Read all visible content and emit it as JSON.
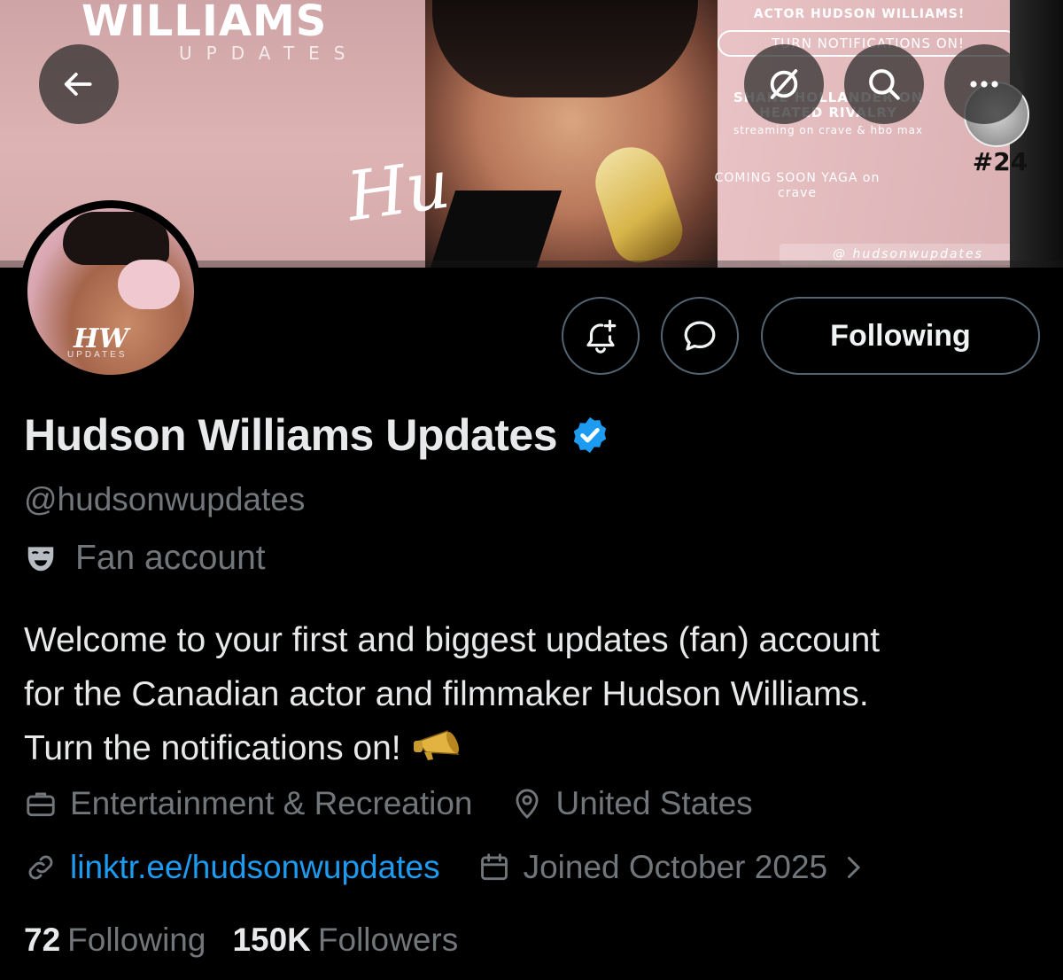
{
  "banner": {
    "wordmark_title": "WILLIAMS",
    "wordmark_subtitle": "UPDATES",
    "promo_line": "ACTOR HUDSON WILLIAMS!",
    "promo_notifications": "TURN NOTIFICATIONS ON!",
    "promo_show": "SHANE HOLLANDER ON HEATED RIVALRY",
    "promo_streaming": "streaming on crave & hbo max",
    "promo_coming_soon": "COMING SOON YAGA on crave",
    "promo_handle": "@ hudsonwupdates",
    "promo_number": "#24"
  },
  "nav": {
    "back_icon": "arrow-left-icon",
    "grok_icon": "grok-icon",
    "search_icon": "search-icon",
    "more_icon": "more-icon"
  },
  "actions": {
    "notify_icon": "bell-plus-icon",
    "message_icon": "message-icon",
    "following_label": "Following"
  },
  "profile": {
    "display_name": "Hudson Williams Updates",
    "verified": true,
    "handle": "@hudsonwupdates",
    "account_label": "Fan account",
    "bio_line1": "Welcome to your first and biggest updates (fan) account",
    "bio_line2": "for the Canadian actor and filmmaker Hudson Williams.",
    "bio_line3": "Turn the notifications on!",
    "professional_category": "Entertainment & Recreation",
    "location": "United States",
    "website": "linktr.ee/hudsonwupdates",
    "joined": "Joined October 2025"
  },
  "stats": {
    "following_count": "72",
    "following_label": "Following",
    "followers_count": "150K",
    "followers_label": "Followers"
  },
  "colors": {
    "background": "#000000",
    "primary_text": "#e7e9ea",
    "secondary_text": "#71767b",
    "link": "#1d9bf0",
    "verified_badge": "#1d9bf0",
    "button_border": "#536471"
  }
}
